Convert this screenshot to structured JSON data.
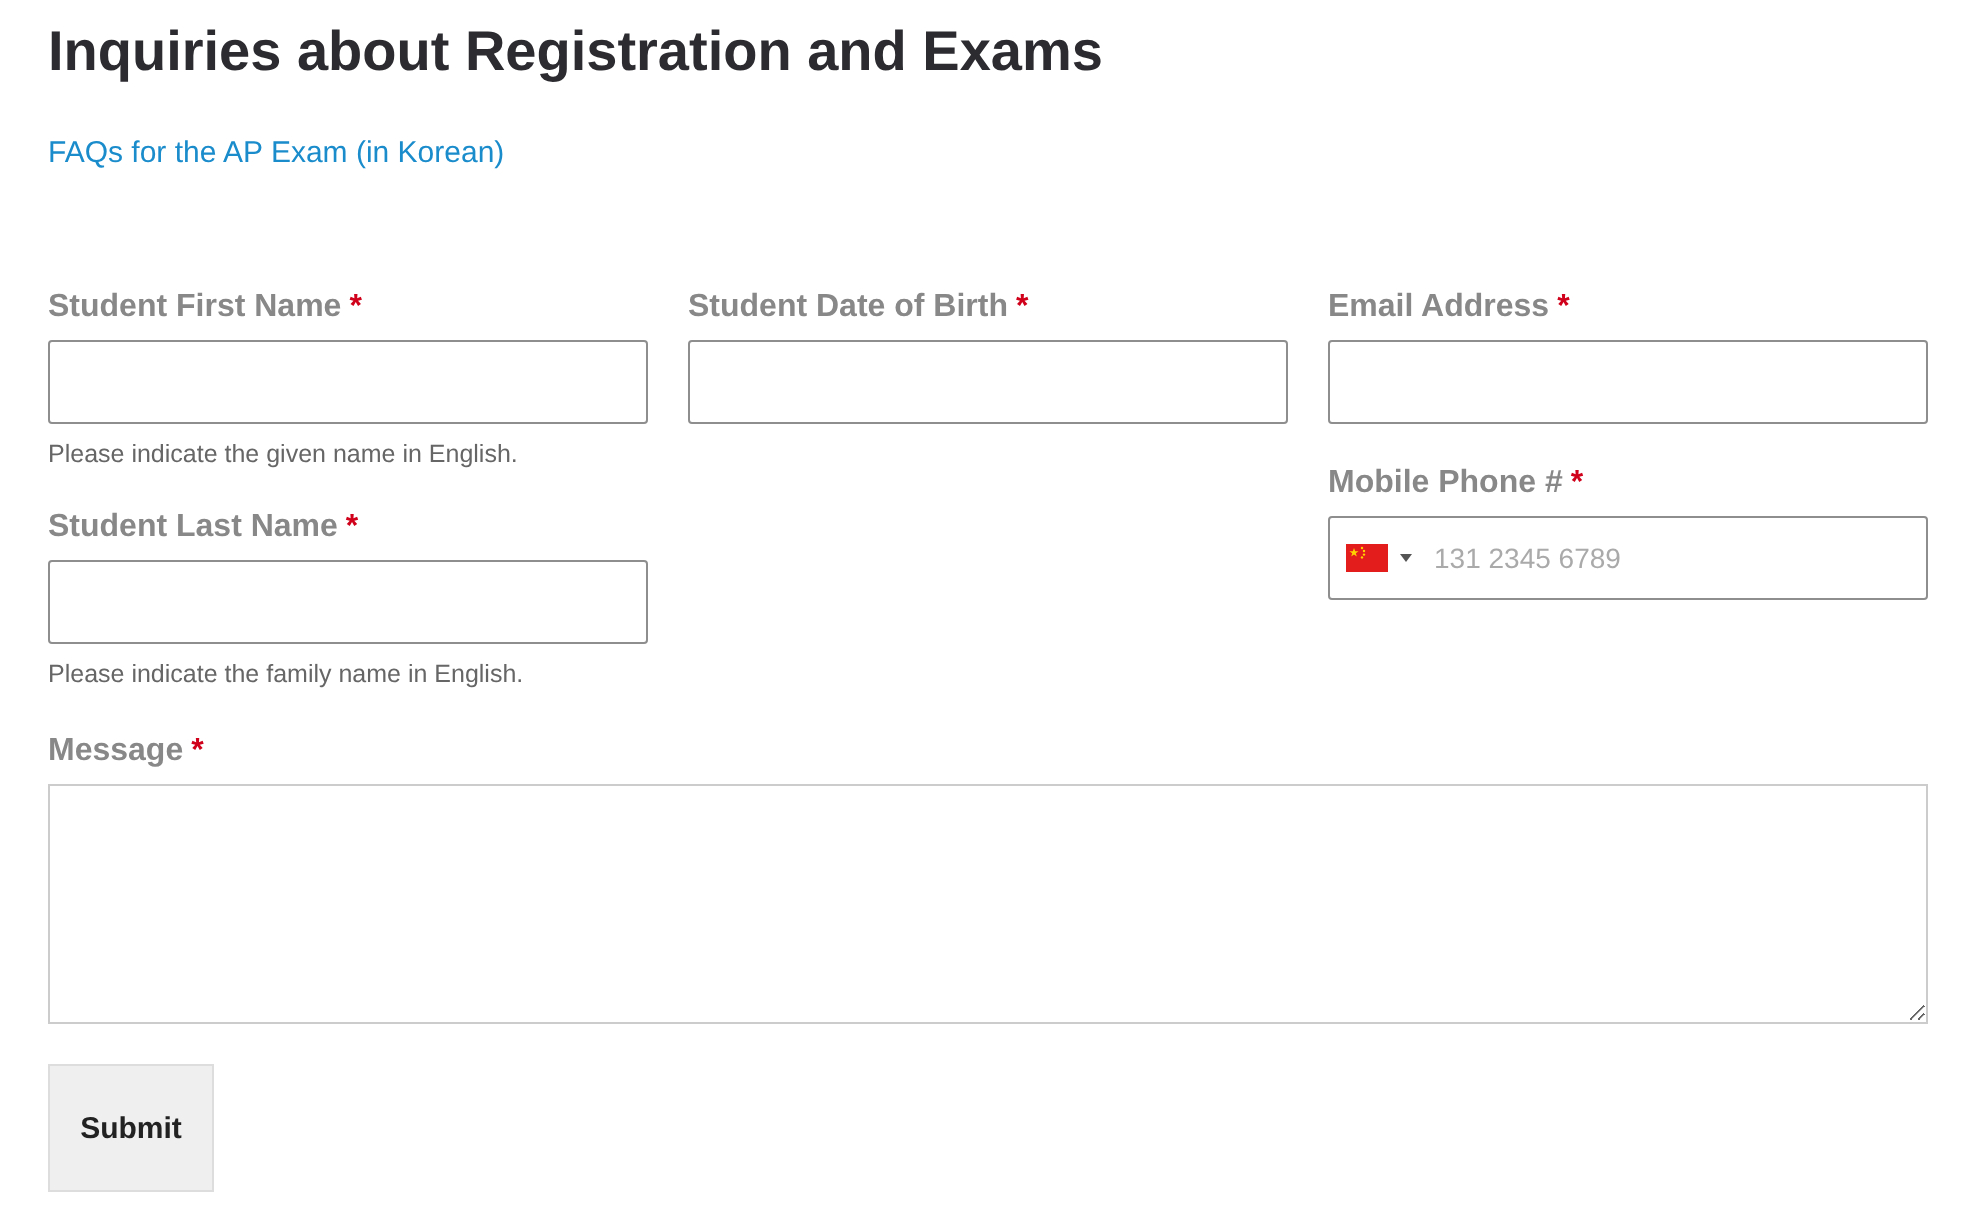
{
  "title": "Inquiries about Registration and Exams",
  "link": "FAQs for the AP Exam (in Korean)",
  "columns": [
    [
      {
        "kind": "text",
        "label": "Student First Name",
        "required_mark": "*",
        "hint": "Please indicate the given name in English."
      },
      {
        "kind": "text",
        "label": "Student Last Name",
        "required_mark": "*",
        "hint": "Please indicate the family name in English."
      }
    ],
    [
      {
        "kind": "text",
        "label": "Student Date of Birth",
        "required_mark": "*"
      }
    ],
    [
      {
        "kind": "text",
        "label": "Email Address",
        "required_mark": "*"
      },
      {
        "kind": "phone",
        "label": "Mobile Phone #",
        "required_mark": "*",
        "placeholder": "131 2345 6789"
      }
    ]
  ],
  "message": {
    "label": "Message",
    "required_mark": "*"
  },
  "submit": "Submit"
}
